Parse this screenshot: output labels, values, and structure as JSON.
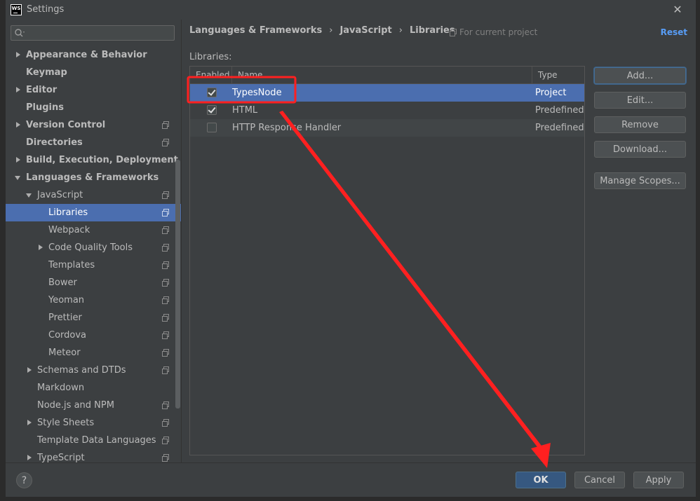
{
  "window": {
    "title": "Settings",
    "logo_text": "WS"
  },
  "sidebar": {
    "search_placeholder": "",
    "items": [
      {
        "label": "Appearance & Behavior"
      },
      {
        "label": "Keymap"
      },
      {
        "label": "Editor"
      },
      {
        "label": "Plugins"
      },
      {
        "label": "Version Control"
      },
      {
        "label": "Directories"
      },
      {
        "label": "Build, Execution, Deployment"
      },
      {
        "label": "Languages & Frameworks"
      },
      {
        "label": "JavaScript"
      },
      {
        "label": "Libraries"
      },
      {
        "label": "Webpack"
      },
      {
        "label": "Code Quality Tools"
      },
      {
        "label": "Templates"
      },
      {
        "label": "Bower"
      },
      {
        "label": "Yeoman"
      },
      {
        "label": "Prettier"
      },
      {
        "label": "Cordova"
      },
      {
        "label": "Meteor"
      },
      {
        "label": "Schemas and DTDs"
      },
      {
        "label": "Markdown"
      },
      {
        "label": "Node.js and NPM"
      },
      {
        "label": "Style Sheets"
      },
      {
        "label": "Template Data Languages"
      },
      {
        "label": "TypeScript"
      }
    ]
  },
  "main": {
    "breadcrumb": [
      "Languages & Frameworks",
      "JavaScript",
      "Libraries"
    ],
    "breadcrumb_sep": "›",
    "scope_note": "For current project",
    "reset_label": "Reset",
    "libraries_label": "Libraries:",
    "columns": {
      "enabled": "Enabled",
      "name": "Name",
      "type": "Type"
    },
    "rows": [
      {
        "name": "TypesNode",
        "type": "Project",
        "enabled": true
      },
      {
        "name": "HTML",
        "type": "Predefined",
        "enabled": true
      },
      {
        "name": "HTTP Response Handler",
        "type": "Predefined",
        "enabled": false
      }
    ],
    "buttons": {
      "add": "Add...",
      "edit": "Edit...",
      "remove": "Remove",
      "download": "Download...",
      "manage_scopes": "Manage Scopes..."
    }
  },
  "footer": {
    "help": "?",
    "ok": "OK",
    "cancel": "Cancel",
    "apply": "Apply"
  },
  "colors": {
    "selection": "#4b6eaf",
    "background": "#3c3f41",
    "link": "#589df6",
    "annotation": "#ff2020"
  }
}
